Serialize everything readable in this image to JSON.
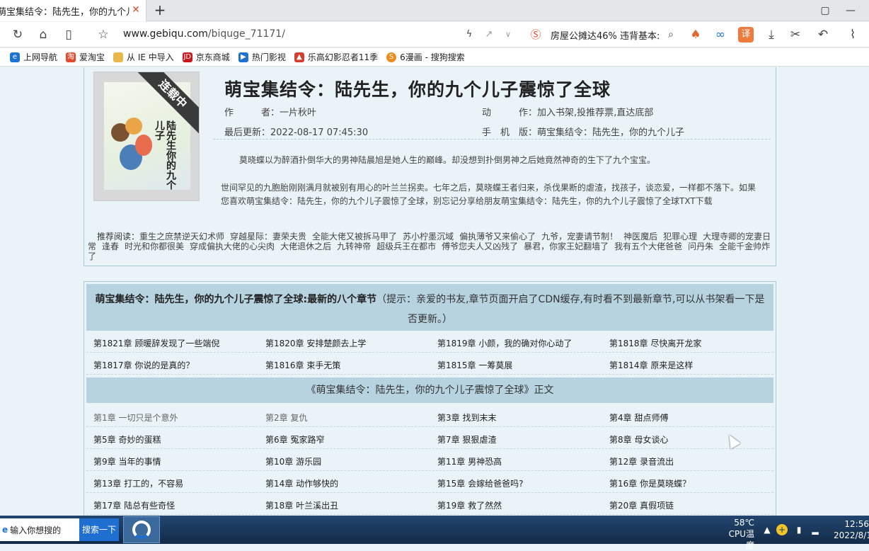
{
  "browser": {
    "tab_title": "萌宝集结令：陆先生，你的九个儿子",
    "tab_close": "✕",
    "new_tab": "+",
    "url_domain": "www.gebiqu.com",
    "url_path": "/biquge_71171/",
    "news_text": "房屋公摊达46% 违背基本:",
    "bookmarks": [
      {
        "label": "上网导航",
        "icon": "ie-icon",
        "color": "#1e73d2"
      },
      {
        "label": "爱淘宝",
        "icon": "taobao-icon",
        "color": "#e04a2e"
      },
      {
        "label": "从 IE 中导入",
        "icon": "folder-icon",
        "color": "#e8b84a"
      },
      {
        "label": "京东商城",
        "icon": "jd-icon",
        "color": "#c8161d"
      },
      {
        "label": "热门影视",
        "icon": "video-icon",
        "color": "#1e73d2"
      },
      {
        "label": "乐高幻影忍者11季",
        "icon": "lego-icon",
        "color": "#d3402f"
      },
      {
        "label": "6漫画 - 搜狗搜索",
        "icon": "sogou-icon",
        "color": "#f08a1c"
      }
    ]
  },
  "book": {
    "title": "萌宝集结令：陆先生，你的九个儿子震惊了全球",
    "cover_badge": "连载中",
    "cover_text": "陆先生你的九个儿子",
    "author_label": "作　　　者：",
    "author": "一片秋叶",
    "action_label": "动　　　作：",
    "actions": [
      "加入书架",
      "投推荐票",
      "直达底部"
    ],
    "updated_label": "最后更新：",
    "updated": "2022-08-17 07:45:30",
    "mobile_label": "手　机　版：",
    "mobile": "萌宝集结令：陆先生，你的九个儿子",
    "intro1": "莫晓蝶以为醉酒扑倒华大的男神陆晨旭是她人生的巅峰。却没想到扑倒男神之后她竟然神奇的生下了九个宝宝。",
    "intro2": "世间罕见的九胞胎刚刚满月就被别有用心的叶兰兰拐卖。七年之后，莫晓蝶王者归来，杀伐果断的虐渣，找孩子，谈恋爱，一样都不落下。如果您喜欢萌宝集结令：陆先生，你的九个儿子震惊了全球，别忘记分享给朋友萌宝集结令：陆先生，你的九个儿子震惊了全球TXT下载",
    "reco_label": "推荐阅读：",
    "reco": [
      "重生之庶禁逆天幻术师",
      "穿越星际：妻荣夫贵",
      "全能大佬又被拆马甲了",
      "苏小柠墨沉域",
      "偏执薄爷又来偷心了",
      "九爷，宠妻请节制！",
      "神医魔后",
      "犯罪心理",
      "大理寺卿的宠妻日常",
      "逢春",
      "时光和你都很美",
      "穿成偏执大佬的心尖肉",
      "大佬退休之后",
      "九转神帝",
      "超级兵王在都市",
      "傅爷您夫人又凶残了",
      "暴君，你家王妃翻墙了",
      "我有五个大佬爸爸",
      "问丹朱",
      "全能千金帅炸了"
    ]
  },
  "chapters": {
    "latest_title": "萌宝集结令：陆先生，你的九个儿子震惊了全球:最新的八个章节",
    "latest_tip": "（提示：亲爱的书友,章节页面开启了CDN缓存,有时看不到最新章节,可以从书架看一下是否更新。）",
    "latest": [
      "第1821章 顾暖辞发现了一些端倪",
      "第1820章 安排楚颜去上学",
      "第1819章 小颜，我的确对你心动了",
      "第1818章 尽快离开龙家",
      "第1817章 你说的是真的？",
      "第1816章 束手无策",
      "第1815章 一筹莫展",
      "第1814章 原来是这样"
    ],
    "main_title": "《萌宝集结令：陆先生，你的九个儿子震惊了全球》正文",
    "main": [
      "第1章 一切只是个意外",
      "第2章 复仇",
      "第3章 找到末末",
      "第4章 甜点师傅",
      "第5章 奇妙的蛋糕",
      "第6章 冤家路窄",
      "第7章 狠狠虐渣",
      "第8章 母女谈心",
      "第9章 当年的事情",
      "第10章 游乐园",
      "第11章 男神恐高",
      "第12章 录音流出",
      "第13章 打工的，不容易",
      "第14章 动作够快的",
      "第15章 会嫁给爸爸吗?",
      "第16章 你是莫晓蝶？",
      "第17章 陆总有些奇怪",
      "第18章 叶兰溪出丑",
      "第19章 救了然然",
      "第20章 真假项链"
    ]
  },
  "taskbar": {
    "search_placeholder": "输入你想搜的",
    "search_button": "搜索一下",
    "temp": "58℃",
    "temp_label": "CPU温度",
    "time": "12:56",
    "date": "2022/8/1"
  }
}
